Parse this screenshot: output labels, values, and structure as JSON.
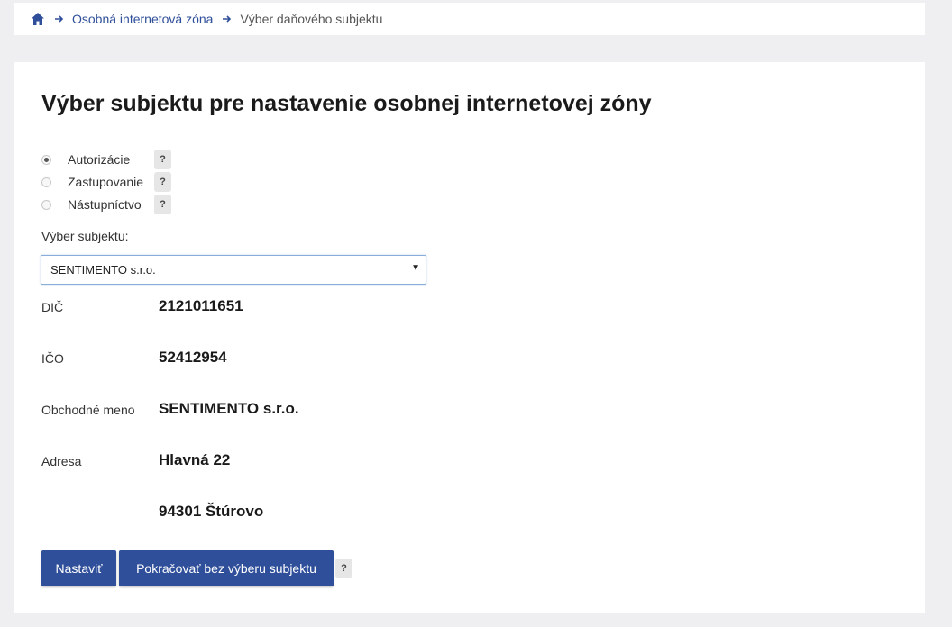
{
  "breadcrumb": {
    "home_icon": "home-icon",
    "items": [
      {
        "label": "Osobná internetová zóna"
      },
      {
        "label": "Výber daňového subjektu"
      }
    ]
  },
  "page": {
    "title": "Výber subjektu pre nastavenie osobnej internetovej zóny"
  },
  "radio_options": [
    {
      "label": "Autorizácie",
      "checked": true,
      "help": "?"
    },
    {
      "label": "Zastupovanie",
      "checked": false,
      "help": "?"
    },
    {
      "label": "Nástupníctvo",
      "checked": false,
      "help": "?"
    }
  ],
  "subject_select": {
    "label": "Výber subjektu:",
    "value": "SENTIMENTO s.r.o.",
    "arrow": "▼"
  },
  "details": [
    {
      "label": "DIČ",
      "value": "2121011651"
    },
    {
      "label": "IČO",
      "value": "52412954"
    },
    {
      "label": "Obchodné meno",
      "value": "SENTIMENTO s.r.o."
    },
    {
      "label": "Adresa",
      "value": "Hlavná 22"
    },
    {
      "label": "",
      "value": "94301 Štúrovo"
    }
  ],
  "buttons": {
    "set_label": "Nastaviť",
    "continue_label": "Pokračovať bez výberu subjektu",
    "help": "?"
  },
  "colors": {
    "primary": "#2f4f9a",
    "background": "#efeff2"
  }
}
